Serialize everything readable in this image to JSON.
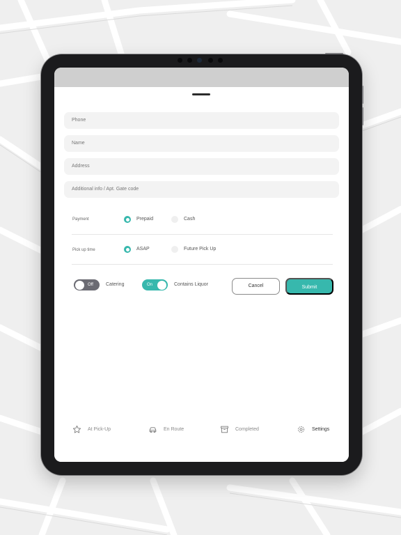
{
  "form": {
    "phone_placeholder": "Phone",
    "name_placeholder": "Name",
    "address_placeholder": "Address",
    "additional_placeholder": "Additional info / Apt. Gate code"
  },
  "payment": {
    "label": "Payment",
    "options": [
      "Prepaid",
      "Cash"
    ],
    "selected": "Prepaid"
  },
  "pickup": {
    "label": "Pick up time",
    "options": [
      "ASAP",
      "Future Pick Up"
    ],
    "selected": "ASAP"
  },
  "toggles": {
    "catering": {
      "state_text": "Off",
      "label": "Catering",
      "on": false
    },
    "liquor": {
      "state_text": "On",
      "label": "Contains Liquor",
      "on": true
    }
  },
  "buttons": {
    "cancel": "Cancel",
    "submit": "Submit"
  },
  "tabs": [
    {
      "label": "At Pick-Up",
      "icon": "star-icon"
    },
    {
      "label": "En Route",
      "icon": "car-icon"
    },
    {
      "label": "Completed",
      "icon": "archive-box-icon"
    },
    {
      "label": "Settings",
      "icon": "gear-icon"
    }
  ],
  "active_tab": "Settings",
  "colors": {
    "accent": "#37b8ad",
    "toggle_off": "#6b6b73",
    "field_bg": "#f3f3f3"
  }
}
